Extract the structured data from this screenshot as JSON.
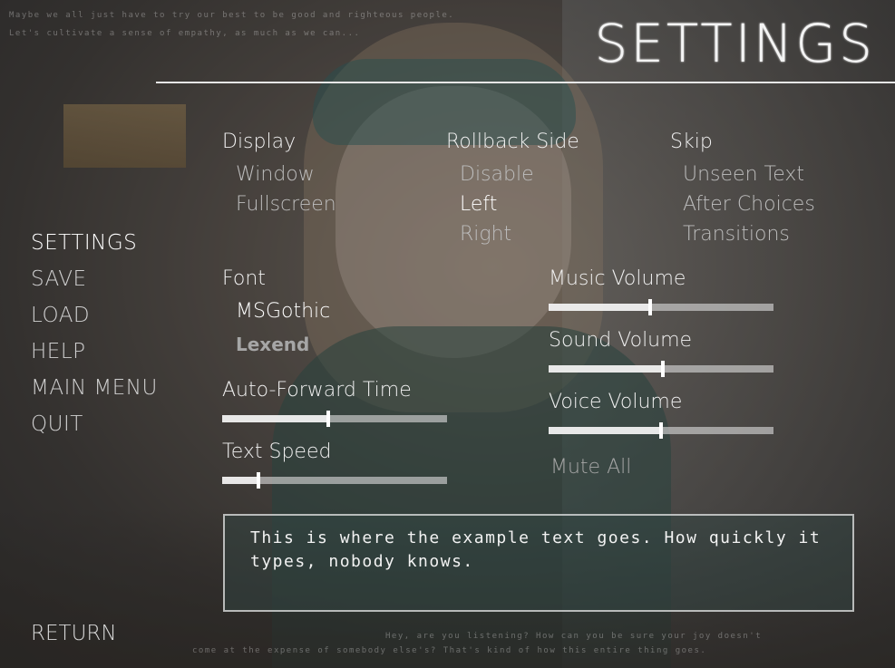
{
  "title": "SETTINGS",
  "quotes": {
    "top_line1": "Maybe we all just have to try our best to be good and righteous people.",
    "top_line2": "Let's cultivate a sense of empathy, as much as we can...",
    "bottom_line1": "Hey, are you listening? How can you be sure your joy doesn't",
    "bottom_line2": "come at the expense of somebody else's? That's kind of how this entire thing goes."
  },
  "nav": {
    "items": [
      "SETTINGS",
      "SAVE",
      "LOAD",
      "HELP",
      "MAIN MENU",
      "QUIT"
    ],
    "active": "SETTINGS",
    "return_label": "RETURN"
  },
  "display": {
    "title": "Display",
    "options": [
      "Window",
      "Fullscreen"
    ]
  },
  "rollback": {
    "title": "Rollback Side",
    "options": [
      "Disable",
      "Left",
      "Right"
    ],
    "selected": "Left"
  },
  "skip": {
    "title": "Skip",
    "options": [
      "Unseen Text",
      "After Choices",
      "Transitions"
    ]
  },
  "font": {
    "title": "Font",
    "options": [
      "MSGothic",
      "Lexend"
    ],
    "selected": "MSGothic"
  },
  "auto_forward": {
    "title": "Auto-Forward Time",
    "value": 0.47
  },
  "text_speed": {
    "title": "Text Speed",
    "value": 0.16
  },
  "music_volume": {
    "title": "Music Volume",
    "value": 0.45
  },
  "sound_volume": {
    "title": "Sound Volume",
    "value": 0.51
  },
  "voice_volume": {
    "title": "Voice Volume",
    "value": 0.5
  },
  "mute_all_label": "Mute All",
  "sample_text": "This is where the example text goes. How quickly it types, nobody knows.",
  "colors": {
    "text": "#e8e8e8",
    "selected": "#ffffff",
    "unselected": "#bdbdbd"
  }
}
